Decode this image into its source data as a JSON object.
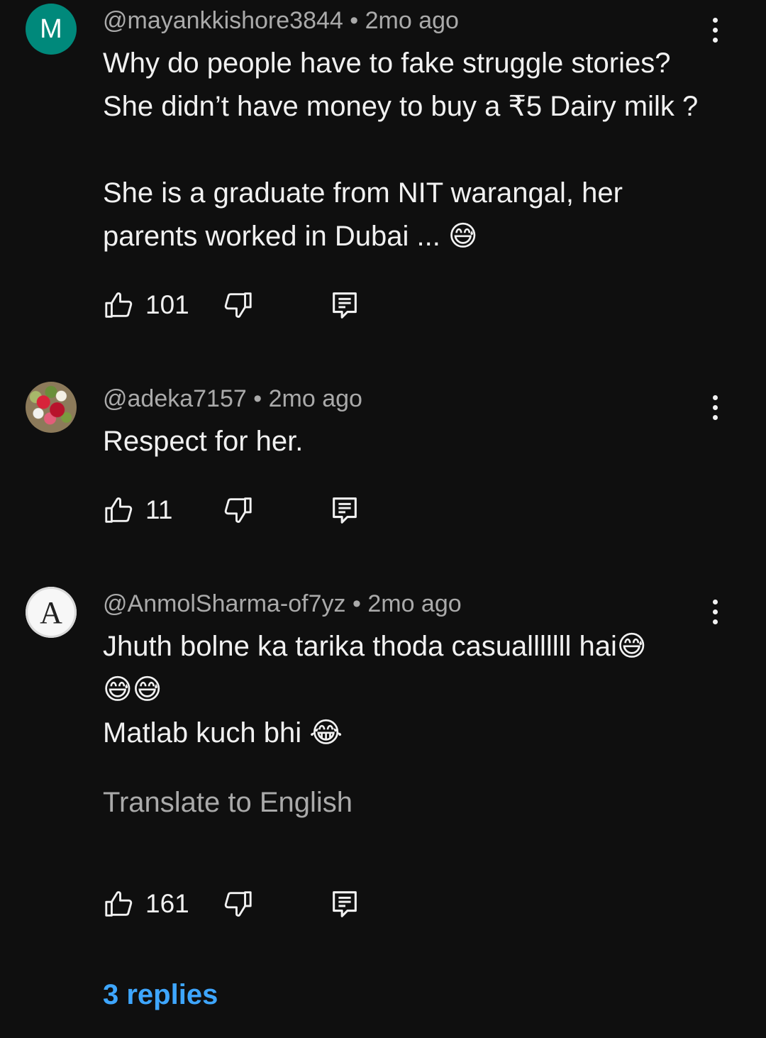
{
  "comments": [
    {
      "avatar_letter": "M",
      "handle": "@mayankkishore3844",
      "time": "2mo ago",
      "text": "Why do people have to fake struggle stories?\nShe didn’t have money to buy a ₹5 Dairy milk ?\n\nShe is a graduate from NIT warangal, her\nparents worked in Dubai ... 😅",
      "likes": "101"
    },
    {
      "avatar_letter": "",
      "handle": "@adeka7157",
      "time": "2mo ago",
      "text": "Respect for her.",
      "likes": "11"
    },
    {
      "avatar_letter": "A",
      "handle": "@AnmolSharma-of7yz",
      "time": "2mo ago",
      "text": "Jhuth bolne ka tarika thoda casualllllll hai😅\n😅😅\nMatlab kuch bhi 😂",
      "translate": "Translate to English",
      "likes": "161",
      "replies": "3 replies"
    }
  ],
  "separator": "•",
  "icons": [
    "like-icon",
    "dislike-icon",
    "reply-icon",
    "more-vert-icon"
  ],
  "colors": {
    "background": "#0f0f0f",
    "meta": "#aaaaaa",
    "link": "#3ea6ff",
    "avatar_m": "#00897b"
  }
}
